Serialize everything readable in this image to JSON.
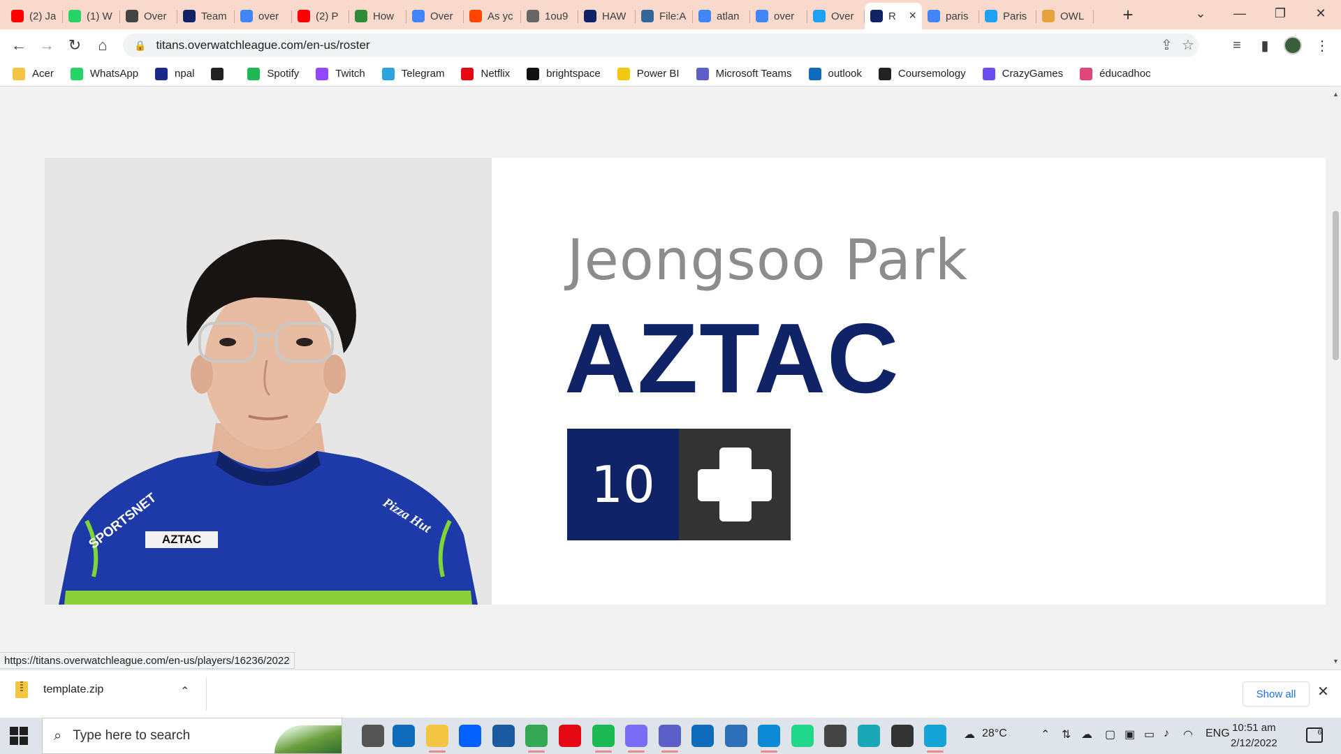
{
  "browser": {
    "tabs": [
      {
        "label": "(2) Ja",
        "icon": "youtube-icon",
        "color": "#ff0000"
      },
      {
        "label": "(1) W",
        "icon": "whatsapp-icon",
        "color": "#25d366"
      },
      {
        "label": "Over",
        "icon": "overwatch-icon",
        "color": "#444444"
      },
      {
        "label": "Team",
        "icon": "titans-icon",
        "color": "#0f2366"
      },
      {
        "label": "over",
        "icon": "google-icon",
        "color": "#4285f4"
      },
      {
        "label": "(2) P",
        "icon": "youtube-icon",
        "color": "#ff0000"
      },
      {
        "label": "How",
        "icon": "wikihow-icon",
        "color": "#2e8b3a"
      },
      {
        "label": "Over",
        "icon": "google-icon",
        "color": "#4285f4"
      },
      {
        "label": "As yc",
        "icon": "reddit-icon",
        "color": "#ff4500"
      },
      {
        "label": "1ou9",
        "icon": "globe-icon",
        "color": "#666666"
      },
      {
        "label": "HAW",
        "icon": "titans-icon",
        "color": "#0f2366"
      },
      {
        "label": "File:A",
        "icon": "wikimedia-icon",
        "color": "#336699"
      },
      {
        "label": "atlan",
        "icon": "google-icon",
        "color": "#4285f4"
      },
      {
        "label": "over",
        "icon": "google-icon",
        "color": "#4285f4"
      },
      {
        "label": "Over",
        "icon": "twitter-icon",
        "color": "#1da1f2"
      },
      {
        "label": "R",
        "icon": "titans-icon",
        "color": "#0f2366",
        "active": true
      },
      {
        "label": "paris",
        "icon": "google-icon",
        "color": "#4285f4"
      },
      {
        "label": "Paris",
        "icon": "twitter-icon",
        "color": "#1da1f2"
      },
      {
        "label": "OWL",
        "icon": "owl-icon",
        "color": "#e6a23c"
      }
    ],
    "url": "titans.overwatchleague.com/en-us/roster",
    "bookmarks": [
      {
        "label": "Acer",
        "icon": "folder-icon",
        "color": "#f4c542"
      },
      {
        "label": "WhatsApp",
        "icon": "whatsapp-icon",
        "color": "#25d366"
      },
      {
        "label": "npal",
        "icon": "npal-icon",
        "color": "#1a2a8a"
      },
      {
        "label": "",
        "icon": "globe-icon",
        "color": "#222222"
      },
      {
        "label": "Spotify",
        "icon": "spotify-icon",
        "color": "#1db954"
      },
      {
        "label": "Twitch",
        "icon": "twitch-icon",
        "color": "#9146ff"
      },
      {
        "label": "Telegram",
        "icon": "telegram-icon",
        "color": "#2aa3df"
      },
      {
        "label": "Netflix",
        "icon": "netflix-icon",
        "color": "#e50914"
      },
      {
        "label": "brightspace",
        "icon": "np-icon",
        "color": "#111111"
      },
      {
        "label": "Power BI",
        "icon": "powerbi-icon",
        "color": "#f2c811"
      },
      {
        "label": "Microsoft Teams",
        "icon": "teams-icon",
        "color": "#5b5fc7"
      },
      {
        "label": "outlook",
        "icon": "outlook-icon",
        "color": "#0f6cbd"
      },
      {
        "label": "Coursemology",
        "icon": "coursemology-icon",
        "color": "#222222"
      },
      {
        "label": "CrazyGames",
        "icon": "crazygames-icon",
        "color": "#6c4cf0"
      },
      {
        "label": "éducadhoc",
        "icon": "educadhoc-icon",
        "color": "#e0457b"
      }
    ],
    "status_url": "https://titans.overwatchleague.com/en-us/players/16236/2022"
  },
  "player": {
    "full_name": "Jeongsoo Park",
    "handle": "AZTAC",
    "number": "10",
    "role_icon": "support-cross-icon",
    "jersey_sponsor": "SPORTSNET",
    "jersey_name": "AZTAC",
    "jersey_brand": "Pizza Hut"
  },
  "download": {
    "filename": "template.zip",
    "show_all": "Show all"
  },
  "taskbar": {
    "search_placeholder": "Type here to search",
    "weather": "28°C",
    "lang": "ENG",
    "time": "10:51 am",
    "date": "2/12/2022",
    "notifications": "6"
  },
  "colors": {
    "brand_navy": "#0f2366",
    "role_box": "#333333",
    "tabstrip": "#f9d9cc",
    "link_blue": "#1a73e8"
  }
}
